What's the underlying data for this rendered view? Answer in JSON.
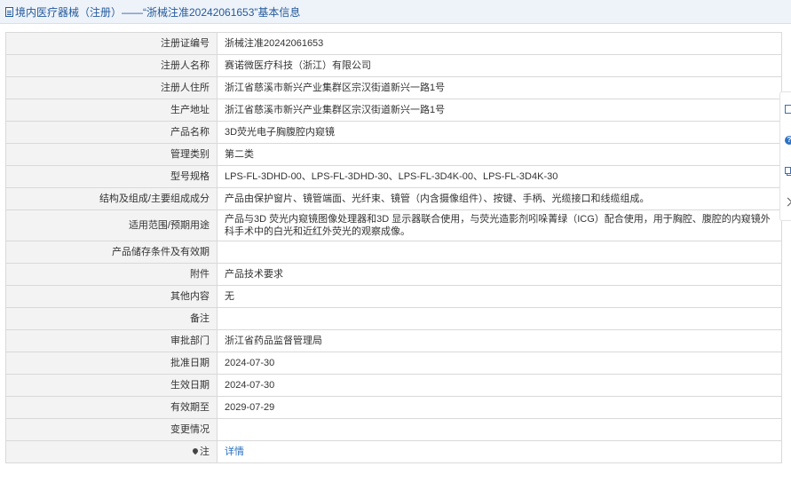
{
  "header": {
    "title": "境内医疗器械（注册）——“浙械注准20242061653”基本信息"
  },
  "rows": [
    {
      "label": "注册证编号",
      "value": "浙械注准20242061653"
    },
    {
      "label": "注册人名称",
      "value": "赛诺微医疗科技（浙江）有限公司"
    },
    {
      "label": "注册人住所",
      "value": "浙江省慈溪市新兴产业集群区宗汉街道新兴一路1号"
    },
    {
      "label": "生产地址",
      "value": "浙江省慈溪市新兴产业集群区宗汉街道新兴一路1号"
    },
    {
      "label": "产品名称",
      "value": "3D荧光电子胸腹腔内窥镜"
    },
    {
      "label": "管理类别",
      "value": "第二类"
    },
    {
      "label": "型号规格",
      "value": "LPS-FL-3DHD-00、LPS-FL-3DHD-30、LPS-FL-3D4K-00、LPS-FL-3D4K-30"
    },
    {
      "label": "结构及组成/主要组成成分",
      "value": "产品由保护窗片、镜管端面、光纤束、镜管（内含摄像组件）、按键、手柄、光缆接口和线缆组成。"
    },
    {
      "label": "适用范围/预期用途",
      "value": "产品与3D 荧光内窥镜图像处理器和3D 显示器联合使用，与荧光造影剂吲哚菁绿（ICG）配合使用，用于胸腔、腹腔的内窥镜外科手术中的白光和近红外荧光的观察成像。"
    },
    {
      "label": "产品储存条件及有效期",
      "value": ""
    },
    {
      "label": "附件",
      "value": "产品技术要求"
    },
    {
      "label": "其他内容",
      "value": "无"
    },
    {
      "label": "备注",
      "value": ""
    },
    {
      "label": "审批部门",
      "value": "浙江省药品监督管理局"
    },
    {
      "label": "批准日期",
      "value": "2024-07-30"
    },
    {
      "label": "生效日期",
      "value": "2024-07-30"
    },
    {
      "label": "有效期至",
      "value": "2029-07-29"
    },
    {
      "label": "变更情况",
      "value": ""
    }
  ],
  "note_row": {
    "label": "注",
    "link_text": "详情"
  },
  "side_toolbar": {
    "icons": [
      "note-icon",
      "help-icon",
      "copy-icon",
      "chevron-right-icon"
    ]
  },
  "colors": {
    "header_bg": "#eef3f9",
    "header_text": "#245a9c",
    "label_bg": "#f3f3f3",
    "border": "#d9d9d9",
    "link": "#2a6fbf"
  }
}
